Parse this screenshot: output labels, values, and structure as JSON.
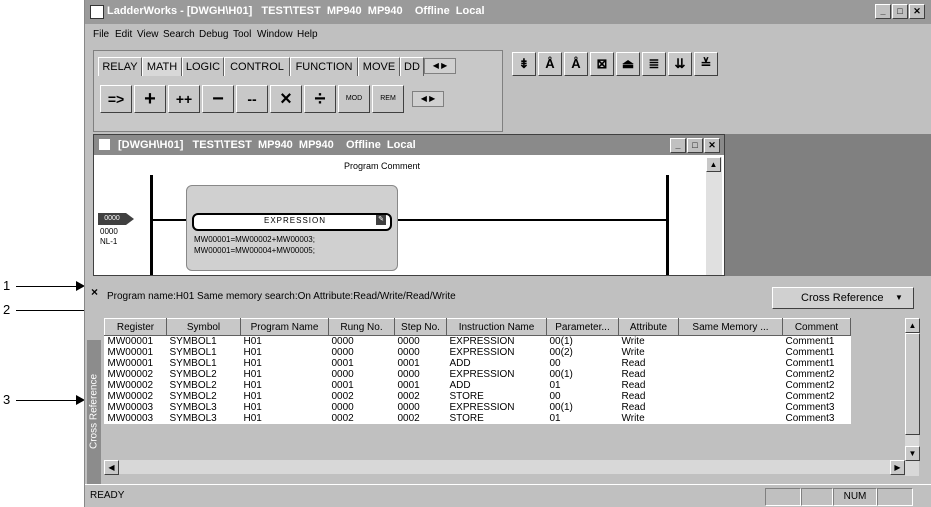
{
  "callouts": [
    "1",
    "2",
    "3"
  ],
  "window": {
    "title": "LadderWorks - [DWGH\\H01]   TEST\\TEST  MP940  MP940    Offline  Local",
    "buttons": [
      "_",
      "□",
      "✕"
    ]
  },
  "menu": [
    "File",
    "Edit",
    "View",
    "Search",
    "Debug",
    "Tool",
    "Window",
    "Help"
  ],
  "toolbar": {
    "tabs": [
      "RELAY",
      "MATH",
      "LOGIC",
      "CONTROL",
      "FUNCTION",
      "MOVE",
      "DD"
    ],
    "math_buttons": [
      "=>",
      "+",
      "++",
      "−",
      "--",
      "×",
      "÷",
      "MOD",
      "REM"
    ],
    "ladder_icons": [
      "rung-insert-icon",
      "contact-a-icon",
      "contact-b-icon",
      "coil-icon",
      "up-arrow-icon",
      "lines-icon",
      "down-icon",
      "equal-icon"
    ]
  },
  "child": {
    "title": "[DWGH\\H01]   TEST\\TEST  MP940  MP940    Offline  Local",
    "program_comment": "Program Comment",
    "step_box": "0000",
    "step_no": "0000",
    "nl": "NL-1",
    "expression_title": "EXPRESSION",
    "expression_line1": "MW00001=MW00002+MW00003;",
    "expression_line2": "MW00001=MW00004+MW00005;"
  },
  "info": {
    "close_mark": "×",
    "text": "Program name:H01  Same memory search:On  Attribute:Read/Write/Read/Write",
    "cross_reference_label": "Cross Reference",
    "dropdown_arrow": "▼"
  },
  "table": {
    "side_label": "Cross Reference",
    "columns": [
      "Register",
      "Symbol",
      "Program Name",
      "Rung No.",
      "Step No.",
      "Instruction Name",
      "Parameter...",
      "Attribute",
      "Same Memory ...",
      "Comment"
    ],
    "rows": [
      [
        "MW00001",
        "SYMBOL1",
        "H01",
        "0000",
        "0000",
        "EXPRESSION",
        "00(1)",
        "Write",
        "",
        "Comment1"
      ],
      [
        "MW00001",
        "SYMBOL1",
        "H01",
        "0000",
        "0000",
        "EXPRESSION",
        "00(2)",
        "Write",
        "",
        "Comment1"
      ],
      [
        "MW00001",
        "SYMBOL1",
        "H01",
        "0001",
        "0001",
        "ADD",
        "00",
        "Read",
        "",
        "Comment1"
      ],
      [
        "MW00002",
        "SYMBOL2",
        "H01",
        "0000",
        "0000",
        "EXPRESSION",
        "00(1)",
        "Read",
        "",
        "Comment2"
      ],
      [
        "MW00002",
        "SYMBOL2",
        "H01",
        "0001",
        "0001",
        "ADD",
        "01",
        "Read",
        "",
        "Comment2"
      ],
      [
        "MW00002",
        "SYMBOL2",
        "H01",
        "0002",
        "0002",
        "STORE",
        "00",
        "Read",
        "",
        "Comment2"
      ],
      [
        "MW00003",
        "SYMBOL3",
        "H01",
        "0000",
        "0000",
        "EXPRESSION",
        "00(1)",
        "Read",
        "",
        "Comment3"
      ],
      [
        "MW00003",
        "SYMBOL3",
        "H01",
        "0002",
        "0002",
        "STORE",
        "01",
        "Write",
        "",
        "Comment3"
      ]
    ]
  },
  "status": {
    "ready": "READY",
    "num": "NUM"
  }
}
